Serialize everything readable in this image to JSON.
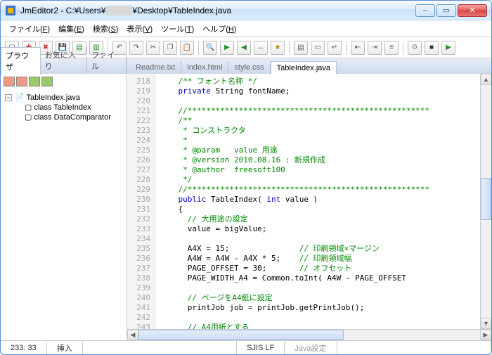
{
  "window": {
    "app_icon_color_a": "#3a6fd8",
    "app_icon_color_b": "#e8b600",
    "title_prefix": "JmEditor2 - C:¥Users¥",
    "title_redacted": "　　　",
    "title_suffix": "¥Desktop¥TableIndex.java",
    "btn_min": "–",
    "btn_max": "▭",
    "btn_close": "✕"
  },
  "menu": [
    {
      "label": "ファイル",
      "key": "F"
    },
    {
      "label": "編集",
      "key": "E"
    },
    {
      "label": "検索",
      "key": "S"
    },
    {
      "label": "表示",
      "key": "V"
    },
    {
      "label": "ツール",
      "key": "T"
    },
    {
      "label": "ヘルプ",
      "key": "H"
    }
  ],
  "toolbar_groups": [
    [
      "new",
      "open",
      "close",
      "save",
      "save-all",
      "save-as"
    ],
    [
      "undo",
      "redo",
      "cut",
      "copy",
      "paste"
    ],
    [
      "find",
      "next",
      "prev",
      "replace",
      "mark"
    ],
    [
      "view-split",
      "view-single",
      "wrap"
    ],
    [
      "outdent",
      "indent",
      "toggle"
    ],
    [
      "settings",
      "macro",
      "run"
    ]
  ],
  "toolbar_glyph": {
    "new": "▢",
    "open": "✚",
    "close": "✖",
    "save": "💾",
    "save-all": "▤",
    "save-as": "▥",
    "undo": "↶",
    "redo": "↷",
    "cut": "✂",
    "copy": "❐",
    "paste": "📋",
    "find": "🔍",
    "next": "▶",
    "prev": "◀",
    "replace": "↔",
    "mark": "★",
    "view-split": "▤",
    "view-single": "▭",
    "wrap": "↵",
    "outdent": "⇤",
    "indent": "⇥",
    "toggle": "≡",
    "settings": "⚙",
    "macro": "■",
    "run": "▶"
  },
  "toolbar_color": {
    "open": "#e03030",
    "close": "#d04040",
    "save": "#2a8a2a",
    "save-all": "#2a8a2a",
    "save-as": "#2a8a2a",
    "next": "#2a8a2a",
    "prev": "#2a8a2a",
    "replace": "#2a8a2a",
    "mark": "#c08000",
    "settings": "#888",
    "macro": "#333",
    "run": "#2a8a2a"
  },
  "sidebar": {
    "tabs": [
      "ブラウザ",
      "お気に入り",
      "ファイル"
    ],
    "active_tab": 0,
    "tree": {
      "root": "TableIndex.java",
      "children": [
        "class TableIndex",
        "class DataComparator"
      ]
    }
  },
  "editor": {
    "tabs": [
      "Readme.txt",
      "index.html",
      "style.css",
      "TableIndex.java"
    ],
    "active_tab": 3,
    "first_line": 218,
    "lines": [
      {
        "t": "cmt",
        "s": "    /** フォント名称 */"
      },
      {
        "t": "mix",
        "s": "    <kw>private</kw> String fontName;"
      },
      {
        "t": "",
        "s": ""
      },
      {
        "t": "cmt",
        "s": "    //****************************************************"
      },
      {
        "t": "cmt",
        "s": "    /**"
      },
      {
        "t": "cmt",
        "s": "     * コンストラクタ"
      },
      {
        "t": "cmt",
        "s": "     *"
      },
      {
        "t": "cmt",
        "s": "     * @param   value 用途"
      },
      {
        "t": "cmt",
        "s": "     * @version 2010.08.16 : 新規作成"
      },
      {
        "t": "cmt",
        "s": "     * @author  freesoft100"
      },
      {
        "t": "cmt",
        "s": "     */"
      },
      {
        "t": "cmt",
        "s": "    //****************************************************"
      },
      {
        "t": "mix",
        "s": "    <kw>public</kw> TableIndex( <kw>int</kw> value )"
      },
      {
        "t": "",
        "s": "    {"
      },
      {
        "t": "cmt",
        "s": "      // 大用途の設定"
      },
      {
        "t": "",
        "s": "      value = bigValue;"
      },
      {
        "t": "",
        "s": ""
      },
      {
        "t": "mix",
        "s": "      A4X = 15;               <cmt>// 印刷領域×マージン</cmt>"
      },
      {
        "t": "mix",
        "s": "      A4W = A4W - A4X * 5;    <cmt>// 印刷領域幅</cmt>"
      },
      {
        "t": "mix",
        "s": "      PAGE_OFFSET = 30;       <cmt>// オフセット</cmt>"
      },
      {
        "t": "",
        "s": "      PAGE_WIDTH_A4 = Common.toInt( A4W - PAGE_OFFSET"
      },
      {
        "t": "",
        "s": ""
      },
      {
        "t": "cmt",
        "s": "      // ページをA4紙に設定"
      },
      {
        "t": "",
        "s": "      printJob job = printJob.getPrintJob();"
      },
      {
        "t": "",
        "s": ""
      },
      {
        "t": "cmt",
        "s": "      // A4用紙とする"
      }
    ]
  },
  "status": {
    "pos": "233: 33",
    "mode": "挿入",
    "encoding": "SJIS LF",
    "lang": "Java設定"
  }
}
